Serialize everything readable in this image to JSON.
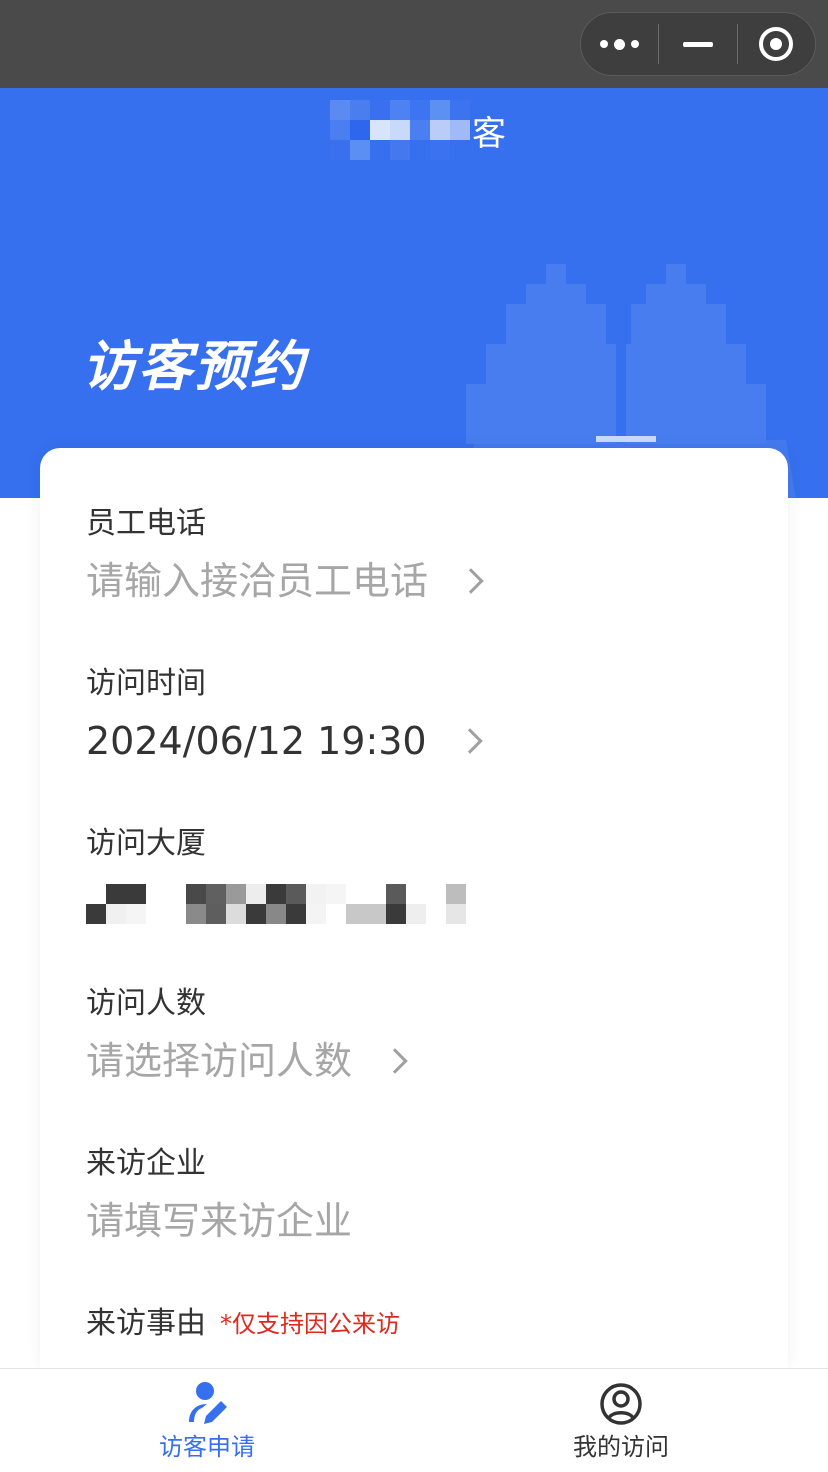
{
  "app": {
    "name_visible_suffix": "客"
  },
  "header": {
    "title": "访客预约"
  },
  "form": {
    "fields": [
      {
        "label": "员工电话",
        "value": "请输入接洽员工电话",
        "is_placeholder": true,
        "has_arrow": true
      },
      {
        "label": "访问时间",
        "value": "2024/06/12 19:30",
        "is_placeholder": false,
        "has_arrow": true
      },
      {
        "label": "访问大厦",
        "value": "",
        "is_placeholder": false,
        "has_arrow": false,
        "redacted": true
      },
      {
        "label": "访问人数",
        "value": "请选择访问人数",
        "is_placeholder": true,
        "has_arrow": true
      },
      {
        "label": "来访企业",
        "value": "请填写来访企业",
        "is_placeholder": true,
        "has_arrow": false
      },
      {
        "label": "来访事由",
        "note": "*仅支持因公来访"
      }
    ]
  },
  "tabbar": {
    "tabs": [
      {
        "label": "访客申请",
        "icon": "person-edit-icon",
        "active": true
      },
      {
        "label": "我的访问",
        "icon": "user-circle-icon",
        "active": false
      }
    ]
  },
  "colors": {
    "primary": "#3670ee",
    "titlebar": "#4a4a4a",
    "placeholder": "#a6a6a6",
    "text": "#333333",
    "note": "#e0281e"
  }
}
